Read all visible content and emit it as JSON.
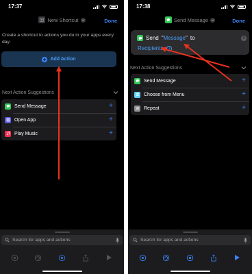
{
  "left_screen": {
    "status": {
      "time": "17:37"
    },
    "nav": {
      "title": "New Shortcut",
      "done_label": "Done"
    },
    "intro_text": "Create a shortcut to actions you do in your apps every day.",
    "add_action_label": "Add Action",
    "suggestions": {
      "title": "Next Action Suggestions",
      "items": [
        {
          "label": "Send Message",
          "icon": "messages-icon",
          "color": "#34c759"
        },
        {
          "label": "Open App",
          "icon": "open-app-icon",
          "color": "#5e5ce6"
        },
        {
          "label": "Play Music",
          "icon": "music-icon",
          "color": "#fa2d55"
        }
      ]
    },
    "search": {
      "placeholder": "Search for apps and actions"
    }
  },
  "right_screen": {
    "status": {
      "time": "17:38"
    },
    "nav": {
      "title": "Send Message",
      "done_label": "Done"
    },
    "action_card": {
      "verb": "Send",
      "open_quote": "\"",
      "message_token": "Message",
      "close_quote": "\"",
      "to_word": "to",
      "recipients_token": "Recipients"
    },
    "suggestions": {
      "title": "Next Action Suggestions",
      "items": [
        {
          "label": "Send Message",
          "icon": "messages-icon",
          "color": "#34c759"
        },
        {
          "label": "Choose from Menu",
          "icon": "menu-icon",
          "color": "#64d2ff"
        },
        {
          "label": "Repeat",
          "icon": "repeat-icon",
          "color": "#8e8e93"
        }
      ]
    },
    "search": {
      "placeholder": "Search for apps and actions"
    }
  },
  "colors": {
    "accent_blue": "#3b82f6",
    "annotation_arrow": "#e8321e",
    "background": "#000000",
    "card": "#1c1c1e"
  }
}
